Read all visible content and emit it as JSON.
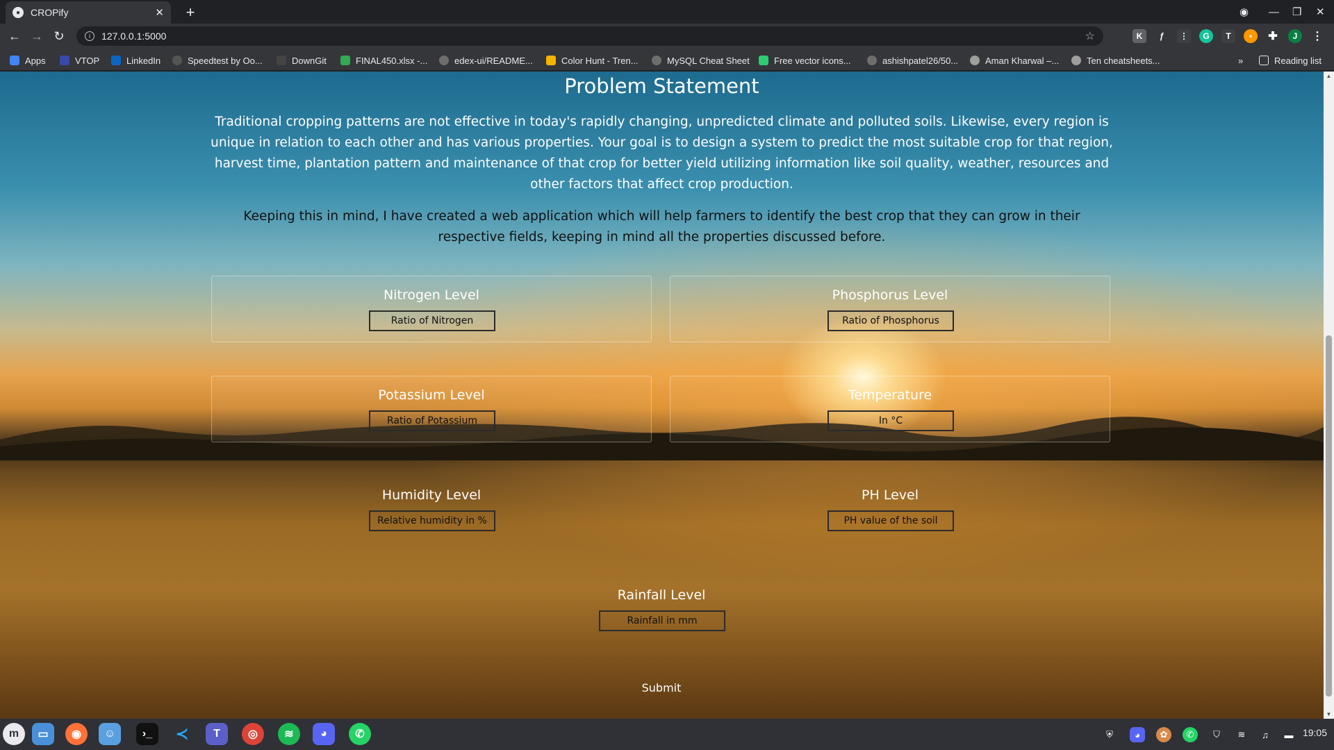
{
  "browser": {
    "tab_title": "CROPify",
    "new_tab": "+",
    "address": "127.0.0.1:5000",
    "bookmarks": [
      {
        "label": "Apps",
        "color": "#4285f4"
      },
      {
        "label": "VTOP",
        "color": "#3949ab"
      },
      {
        "label": "LinkedIn",
        "color": "#0a66c2"
      },
      {
        "label": "Speedtest by Oo...",
        "color": "#555555"
      },
      {
        "label": "DownGit",
        "color": "#444444"
      },
      {
        "label": "FINAL450.xlsx -...",
        "color": "#34a853"
      },
      {
        "label": "edex-ui/README...",
        "color": "#6e6e6e"
      },
      {
        "label": "Color Hunt - Tren...",
        "color": "#f4b400"
      },
      {
        "label": "MySQL Cheat Sheet",
        "color": "#6e6e6e"
      },
      {
        "label": "Free vector icons...",
        "color": "#2ecc71"
      },
      {
        "label": "ashishpatel26/50...",
        "color": "#6e6e6e"
      },
      {
        "label": "Aman Kharwal –...",
        "color": "#9e9e9e"
      },
      {
        "label": "Ten cheatsheets...",
        "color": "#9e9e9e"
      }
    ],
    "overflow": "»",
    "reading_list": "Reading list"
  },
  "page": {
    "title": "Problem Statement",
    "paragraph1": "Traditional cropping patterns are not effective in today's rapidly changing, unpredicted climate and polluted soils. Likewise, every region is unique in relation to each other and has various properties. Your goal is to design a system to predict the most suitable crop for that region, harvest time, plantation pattern and maintenance of that crop for better yield utilizing information like soil quality, weather, resources and other factors that affect crop production.",
    "paragraph2": "Keeping this in mind, I have created a web application which will help farmers to identify the best crop that they can grow in their respective fields, keeping in mind all the properties discussed before.",
    "fields": [
      {
        "label": "Nitrogen Level",
        "placeholder": "Ratio of Nitrogen"
      },
      {
        "label": "Phosphorus Level",
        "placeholder": "Ratio of Phosphorus"
      },
      {
        "label": "Potassium Level",
        "placeholder": "Ratio of Potassium"
      },
      {
        "label": "Temperature",
        "placeholder": "In °C"
      },
      {
        "label": "Humidity Level",
        "placeholder": "Relative humidity in %"
      },
      {
        "label": "PH Level",
        "placeholder": "PH value of the soil"
      },
      {
        "label": "Rainfall Level",
        "placeholder": "Rainfall in mm"
      }
    ],
    "submit_label": "Submit"
  },
  "taskbar": {
    "clock": "19:05",
    "apps": [
      "mint-menu-icon",
      "files-icon",
      "firefox-icon",
      "finder-icon",
      "terminal-icon",
      "vscode-icon",
      "teams-icon",
      "chrome-icon",
      "spotify-icon",
      "discord-icon",
      "whatsapp-icon"
    ]
  }
}
